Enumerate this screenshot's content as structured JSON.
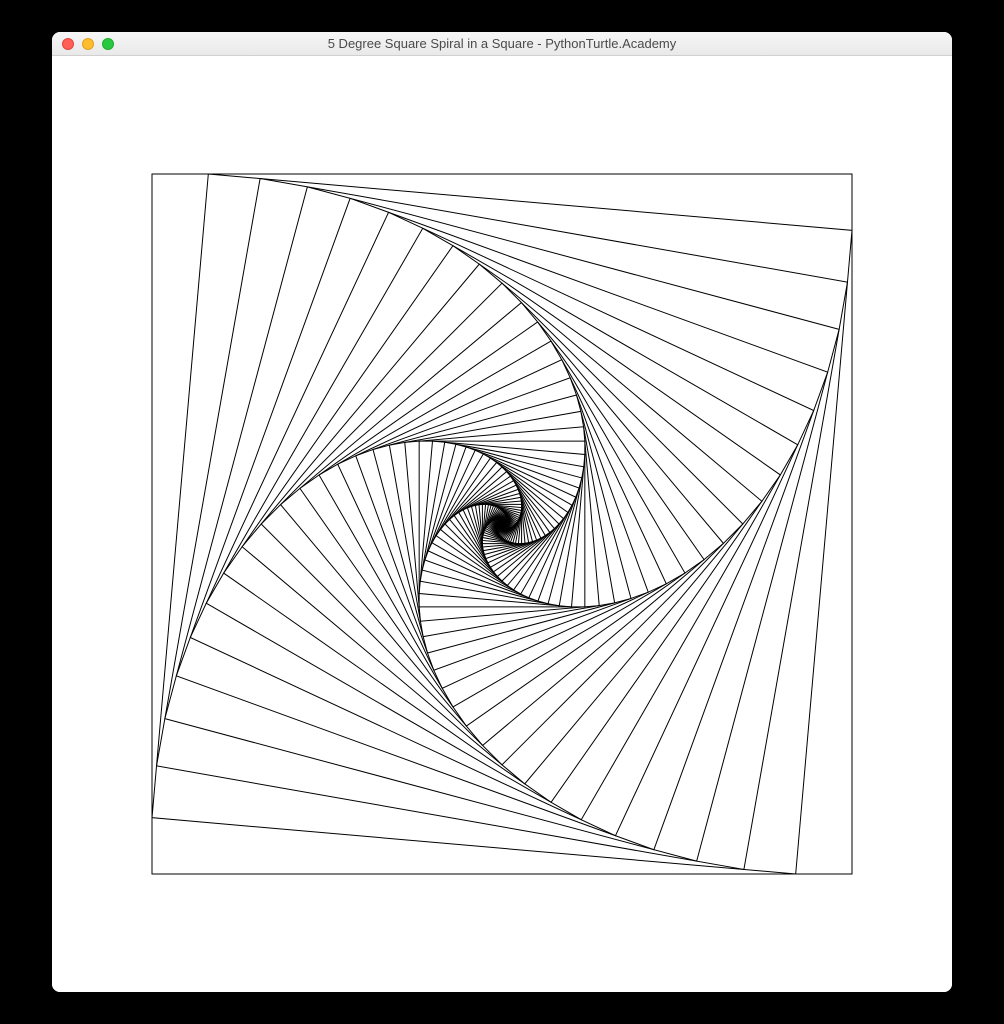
{
  "window": {
    "title": "5 Degree Square Spiral in a Square - PythonTurtle.Academy"
  },
  "chart_data": {
    "type": "spiral",
    "description": "Nested square spiral where each inner square is rotated 5 degrees relative to the outer and scaled to fit inscribed",
    "angle_step_degrees": 5,
    "iterations": 100,
    "outer_square_side": 700,
    "stroke": "#000000",
    "stroke_width": 1,
    "background": "#ffffff"
  }
}
